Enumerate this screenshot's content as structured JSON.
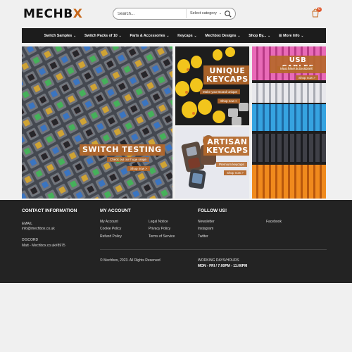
{
  "header": {
    "logo_text_1": "MECHB",
    "logo_text_2": "X",
    "search_placeholder": "Search...",
    "search_category": "Select category",
    "cart_count": "0"
  },
  "nav": {
    "items": [
      {
        "label": "Switch Samples"
      },
      {
        "label": "Switch Packs of 10"
      },
      {
        "label": "Parts & Accessories"
      },
      {
        "label": "Keycaps"
      },
      {
        "label": "Mechbox Designs"
      },
      {
        "label": "Shop By..."
      },
      {
        "label": "More Info"
      }
    ]
  },
  "banners": {
    "switch_testing": {
      "title": "SWITCH TESTING",
      "subtitle": "Check out our huge range",
      "button": "Shop now >"
    },
    "unique_keycaps": {
      "title_1": "UNIQUE",
      "title_2": "KEYCAPS",
      "subtitle": "Make your Board unique",
      "button": "Shop now >"
    },
    "artisan_keycaps": {
      "title_1": "ARTISAN",
      "title_2": "KEYCAPS",
      "subtitle": "Premium keycaps",
      "button": "Shop now >"
    },
    "usb_cables": {
      "title": "USB CABLES",
      "subtitle": "Must have accessories",
      "button": "Shop now >"
    }
  },
  "footer": {
    "contact": {
      "heading": "CONTACT INFORMATION",
      "email_label": "EMAIL",
      "email_value": "info@mechbox.co.uk",
      "discord_label": "DISCORD",
      "discord_value": "Matt - Mechbox.co.uk#8975"
    },
    "account": {
      "heading": "MY ACCOUNT",
      "col1": [
        "My Account",
        "Cookie Policy",
        "Refund Policy"
      ],
      "col2": [
        "Legal Notice",
        "Privacy Policy",
        "Terms of Service"
      ]
    },
    "follow": {
      "heading": "FOLLOW US!",
      "col1": [
        "Newsletter",
        "Instagram",
        "Twitter"
      ],
      "col2": [
        "Facebook"
      ]
    },
    "copyright": "© Mechbox, 2023. All Rights Reserved",
    "hours_label": "WORKING DAYS/HOURS",
    "hours_value": "MON - FRI / 7:00PM - 11:00PM"
  },
  "colors": {
    "accent": "#b5682a",
    "nav_bg": "#1c1c1c",
    "footer_bg": "#232323",
    "cart_badge": "#e0572d"
  }
}
